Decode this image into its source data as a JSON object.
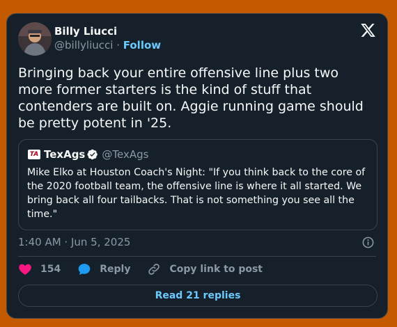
{
  "author": {
    "name": "Billy Liucci",
    "handle": "@billyliucci",
    "separator": "·",
    "follow_label": "Follow"
  },
  "tweet": {
    "text": "Bringing back your entire offensive line plus two more former starters is the kind of stuff that contenders are built on. Aggie running game should be pretty potent in '25.",
    "timestamp": "1:40 AM · Jun 5, 2025"
  },
  "quote": {
    "logo_text": "TA",
    "name": "TexAgs",
    "handle": "@TexAgs",
    "text": "Mike Elko at Houston Coach's Night: \"If you think back to the core of the 2020 football team, the offensive line is where it all started. We bring back all four tailbacks. That is not something you see all the time.\""
  },
  "actions": {
    "like_count": "154",
    "reply_label": "Reply",
    "copy_label": "Copy link to post"
  },
  "read_replies_label": "Read 21 replies",
  "colors": {
    "background": "#c35a00",
    "card": "#15202b",
    "accent": "#6bc9fb",
    "like": "#f91880",
    "reply": "#1d9bf0"
  }
}
